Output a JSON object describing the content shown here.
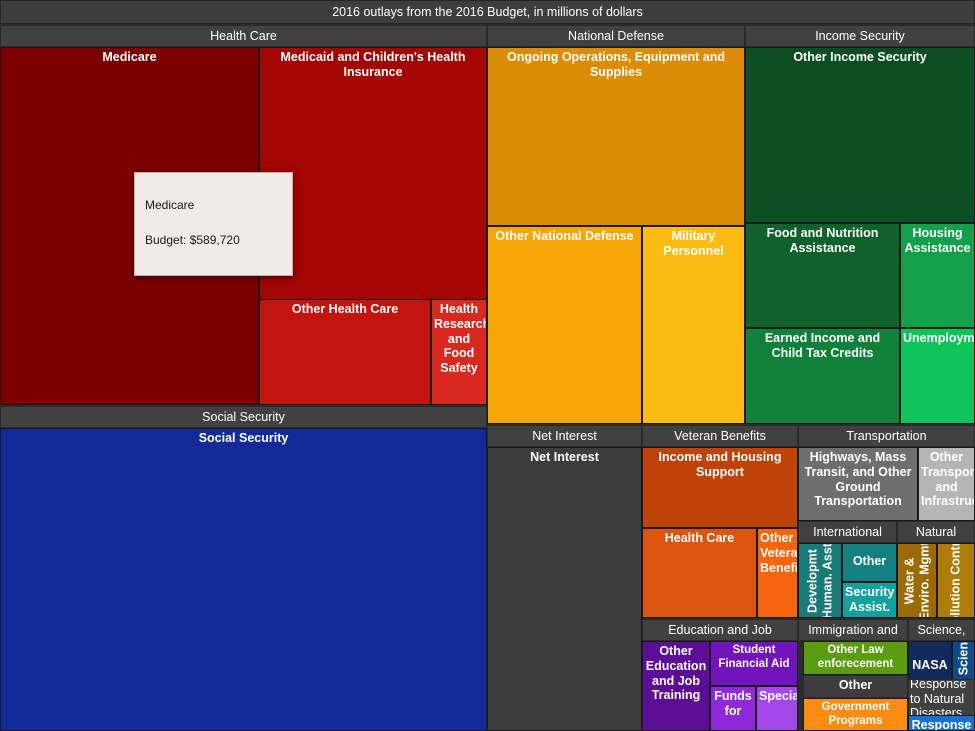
{
  "title": "2016 outlays from the 2016 Budget, in millions of dollars",
  "tooltip": {
    "name": "Medicare",
    "budget_line": "Budget: $589,720"
  },
  "chart_data": {
    "type": "treemap",
    "title": "2016 outlays from the 2016 Budget, in millions of dollars",
    "value_unit": "millions of dollars",
    "hovered_node": {
      "label": "Medicare",
      "value": 589720
    },
    "groups": [
      {
        "label": "Health Care",
        "children": [
          {
            "label": "Medicare",
            "color": "#7d0000"
          },
          {
            "label": "Medicaid and Children's Health Insurance",
            "color": "#a30604"
          },
          {
            "label": "Other Health Care",
            "color": "#c41410"
          },
          {
            "label": "Health Research and Food Safety",
            "color": "#d9281f"
          }
        ]
      },
      {
        "label": "National Defense",
        "children": [
          {
            "label": "Ongoing Operations, Equipment and Supplies",
            "color": "#dd8c07"
          },
          {
            "label": "Other National Defense",
            "color": "#f5a506"
          },
          {
            "label": "Military Personnel",
            "color": "#fcbb13"
          }
        ]
      },
      {
        "label": "Income Security",
        "children": [
          {
            "label": "Other Income Security",
            "color": "#0d4d22"
          },
          {
            "label": "Food and Nutrition Assistance",
            "color": "#10612c"
          },
          {
            "label": "Housing Assistance",
            "color": "#12a04a"
          },
          {
            "label": "Earned Income and Child Tax Credits",
            "color": "#11803a"
          },
          {
            "label": "Unemployment Compensation",
            "color": "#10c45c"
          }
        ]
      },
      {
        "label": "Social Security",
        "children": [
          {
            "label": "Social Security",
            "color": "#132a9b"
          }
        ]
      },
      {
        "label": "Net Interest",
        "children": [
          {
            "label": "Net Interest",
            "color": "#3d3d3d"
          }
        ]
      },
      {
        "label": "Veteran Benefits",
        "children": [
          {
            "label": "Income and Housing Support",
            "color": "#bf4208"
          },
          {
            "label": "Health Care",
            "color": "#db5510"
          },
          {
            "label": "Other Veteran Benefits",
            "color": "#f4650d"
          }
        ]
      },
      {
        "label": "Transportation",
        "children": [
          {
            "label": "Highways, Mass Transit, and Other Ground Transportation",
            "color": "#6e6e6e"
          },
          {
            "label": "Other Transport and Infrastructure",
            "color": "#b5b5b5"
          }
        ]
      },
      {
        "label": "International",
        "children": [
          {
            "label": "Developmt\nHuman. Asst",
            "color": "#1a7a78"
          },
          {
            "label": "Other",
            "color": "#14807f"
          },
          {
            "label": "Security Assist.",
            "color": "#13a0a0"
          }
        ]
      },
      {
        "label": "Natural",
        "children": [
          {
            "label": "Water &\nEnviro. Mgmt",
            "color": "#9c6a06"
          },
          {
            "label": "Pollution Control",
            "color": "#b07c09"
          }
        ]
      },
      {
        "label": "Education and Job",
        "children": [
          {
            "label": "Other Education and Job Training",
            "color": "#5c0f96"
          },
          {
            "label": "Student Financial Aid",
            "color": "#7214bb"
          },
          {
            "label": "Funds for",
            "color": "#8e28d8"
          },
          {
            "label": "Special Educa",
            "color": "#a347e8"
          }
        ]
      },
      {
        "label": "Immigration and",
        "children": [
          {
            "label": "Other Law enforecement",
            "color": "#5c9c10"
          },
          {
            "label": "Other",
            "color": "#3d3d3d"
          },
          {
            "label": "Government Programs",
            "color": "#fa8c14"
          }
        ]
      },
      {
        "label": "Science,",
        "children": [
          {
            "label": "NASA",
            "color": "#132a5c"
          },
          {
            "label": "Other Science",
            "color": "#0f4b8c"
          }
        ]
      },
      {
        "label": "Response to Natural Disasters",
        "children": [
          {
            "label": "Response",
            "color": "#1a6fd4"
          }
        ]
      }
    ]
  }
}
